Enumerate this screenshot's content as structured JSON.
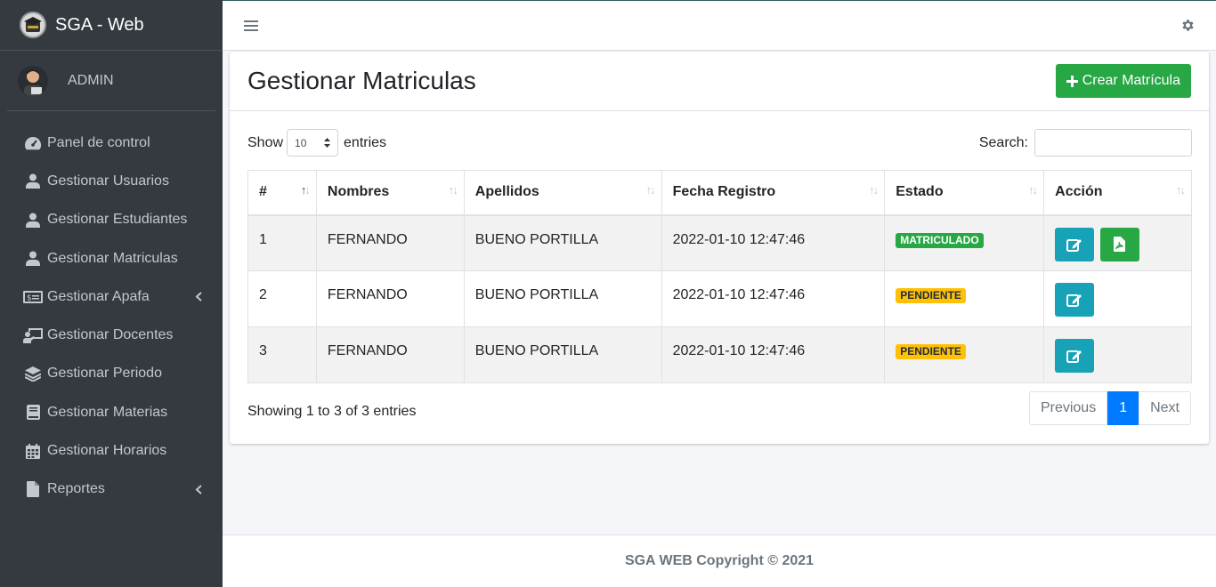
{
  "brand": {
    "name": "SGA - Web"
  },
  "user": {
    "name": "ADMIN"
  },
  "sidebar": {
    "items": [
      {
        "label": "Panel de control",
        "icon": "tachometer-icon"
      },
      {
        "label": "Gestionar Usuarios",
        "icon": "user-icon"
      },
      {
        "label": "Gestionar Estudiantes",
        "icon": "user-icon"
      },
      {
        "label": "Gestionar Matriculas",
        "icon": "user-icon"
      },
      {
        "label": "Gestionar Apafa",
        "icon": "money-bill-icon",
        "caret": true
      },
      {
        "label": "Gestionar Docentes",
        "icon": "chalkboard-teacher-icon"
      },
      {
        "label": "Gestionar Periodo",
        "icon": "layers-icon"
      },
      {
        "label": "Gestionar Materias",
        "icon": "book-icon"
      },
      {
        "label": "Gestionar Horarios",
        "icon": "calendar-icon"
      },
      {
        "label": "Reportes",
        "icon": "file-icon",
        "caret": true
      }
    ]
  },
  "header": {
    "title": "Gestionar Matriculas",
    "create_button": "Crear Matrícula"
  },
  "table_controls": {
    "show_label": "Show",
    "length_value": "10",
    "entries_label": "entries",
    "search_label": "Search:"
  },
  "table": {
    "columns": [
      "#",
      "Nombres",
      "Apellidos",
      "Fecha Registro",
      "Estado",
      "Acción"
    ],
    "rows": [
      {
        "id": "1",
        "nombres": "FERNANDO",
        "apellidos": "BUENO PORTILLA",
        "fecha": "2022-01-10 12:47:46",
        "estado": "MATRICULADO",
        "estado_color": "#28a745",
        "pdf": true
      },
      {
        "id": "2",
        "nombres": "FERNANDO",
        "apellidos": "BUENO PORTILLA",
        "fecha": "2022-01-10 12:47:46",
        "estado": "PENDIENTE",
        "estado_color": "#ffc107",
        "pdf": false
      },
      {
        "id": "3",
        "nombres": "FERNANDO",
        "apellidos": "BUENO PORTILLA",
        "fecha": "2022-01-10 12:47:46",
        "estado": "PENDIENTE",
        "estado_color": "#ffc107",
        "pdf": false
      }
    ],
    "info": "Showing 1 to 3 of 3 entries"
  },
  "pagination": {
    "previous": "Previous",
    "current": "1",
    "next": "Next"
  },
  "footer": {
    "text": "SGA WEB Copyright © 2021"
  },
  "colors": {
    "sidebar": "#343a40",
    "success": "#28a745",
    "info": "#17a2b8",
    "warning": "#ffc107",
    "primary": "#007bff"
  }
}
